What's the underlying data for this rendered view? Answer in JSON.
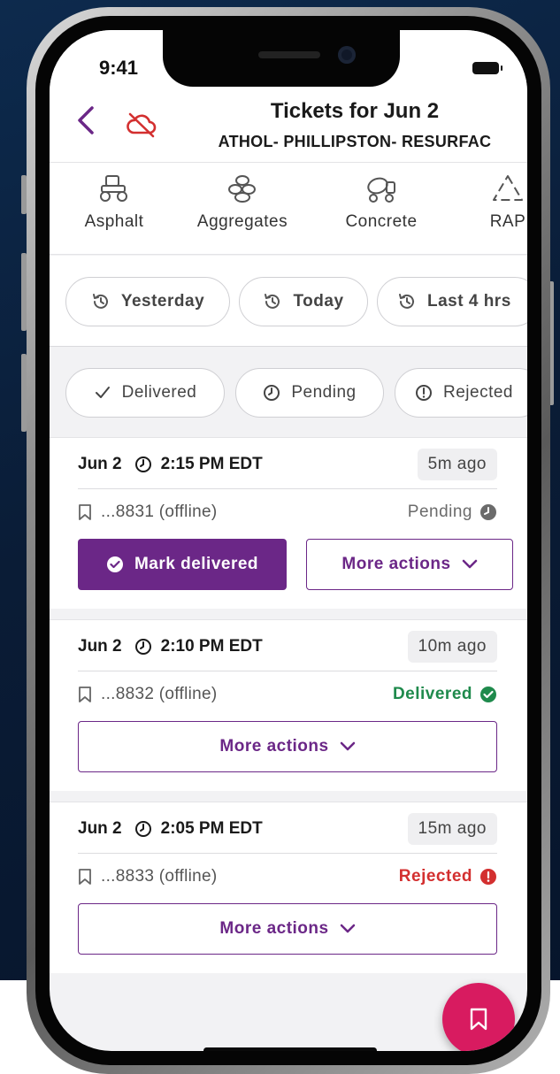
{
  "status_bar": {
    "time": "9:41"
  },
  "header": {
    "title": "Tickets for Jun 2",
    "subtitle": "ATHOL- PHILLIPSTON- RESURFAC",
    "back_icon": "chevron-left-icon",
    "offline_icon": "cloud-off-icon"
  },
  "categories": [
    {
      "label": "Asphalt",
      "icon": "road-roller-icon"
    },
    {
      "label": "Aggregates",
      "icon": "stones-icon"
    },
    {
      "label": "Concrete",
      "icon": "concrete-mixer-icon"
    },
    {
      "label": "RAP",
      "icon": "recycle-icon"
    }
  ],
  "time_filters": [
    {
      "label": "Yesterday",
      "icon": "history-icon"
    },
    {
      "label": "Today",
      "icon": "history-icon"
    },
    {
      "label": "Last 4 hrs",
      "icon": "history-icon"
    }
  ],
  "status_filters": [
    {
      "label": "Delivered",
      "icon": "check-icon"
    },
    {
      "label": "Pending",
      "icon": "clock-icon"
    },
    {
      "label": "Rejected",
      "icon": "alert-circle-icon"
    }
  ],
  "tickets": [
    {
      "date": "Jun 2",
      "time": "2:15 PM EDT",
      "ago": "5m ago",
      "id": "...8831 (offline)",
      "status": "Pending",
      "status_color": "#6b6b6b",
      "primary_action": "Mark delivered",
      "more_actions": "More actions"
    },
    {
      "date": "Jun 2",
      "time": "2:10 PM EDT",
      "ago": "10m ago",
      "id": "...8832 (offline)",
      "status": "Delivered",
      "status_color": "#1f8a4c",
      "more_actions": "More actions"
    },
    {
      "date": "Jun 2",
      "time": "2:05 PM EDT",
      "ago": "15m ago",
      "id": "...8833 (offline)",
      "status": "Rejected",
      "status_color": "#d32f2f",
      "more_actions": "More actions"
    }
  ],
  "colors": {
    "accent": "#6b2787",
    "fab": "#d81b60"
  },
  "fab": {
    "icon": "bookmark-icon"
  }
}
